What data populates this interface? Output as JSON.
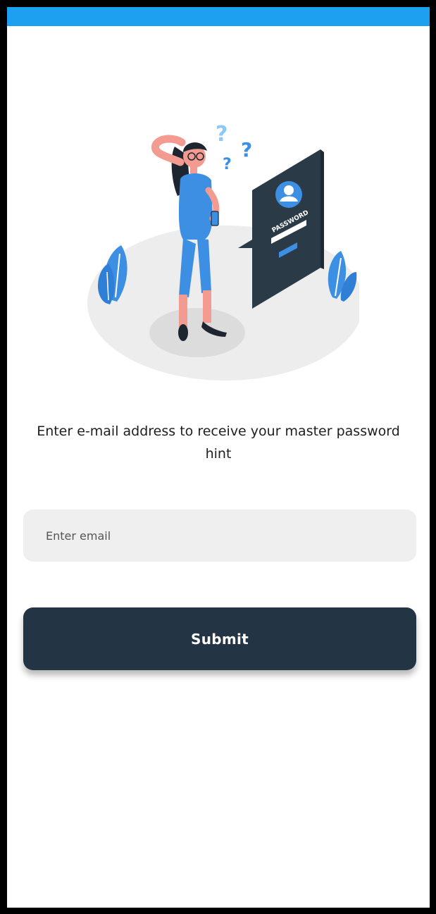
{
  "colors": {
    "status_bar": "#1ea0f0",
    "button_bg": "#233444",
    "field_bg": "#efefef",
    "accent_blue": "#3d8fe3"
  },
  "illustration": {
    "icon": "forgot-password-illustration",
    "card_label": "PASSWORD"
  },
  "prompt": {
    "text": "Enter e-mail address to receive your master password hint"
  },
  "email": {
    "placeholder": "Enter email",
    "value": ""
  },
  "submit": {
    "label": "Submit"
  }
}
